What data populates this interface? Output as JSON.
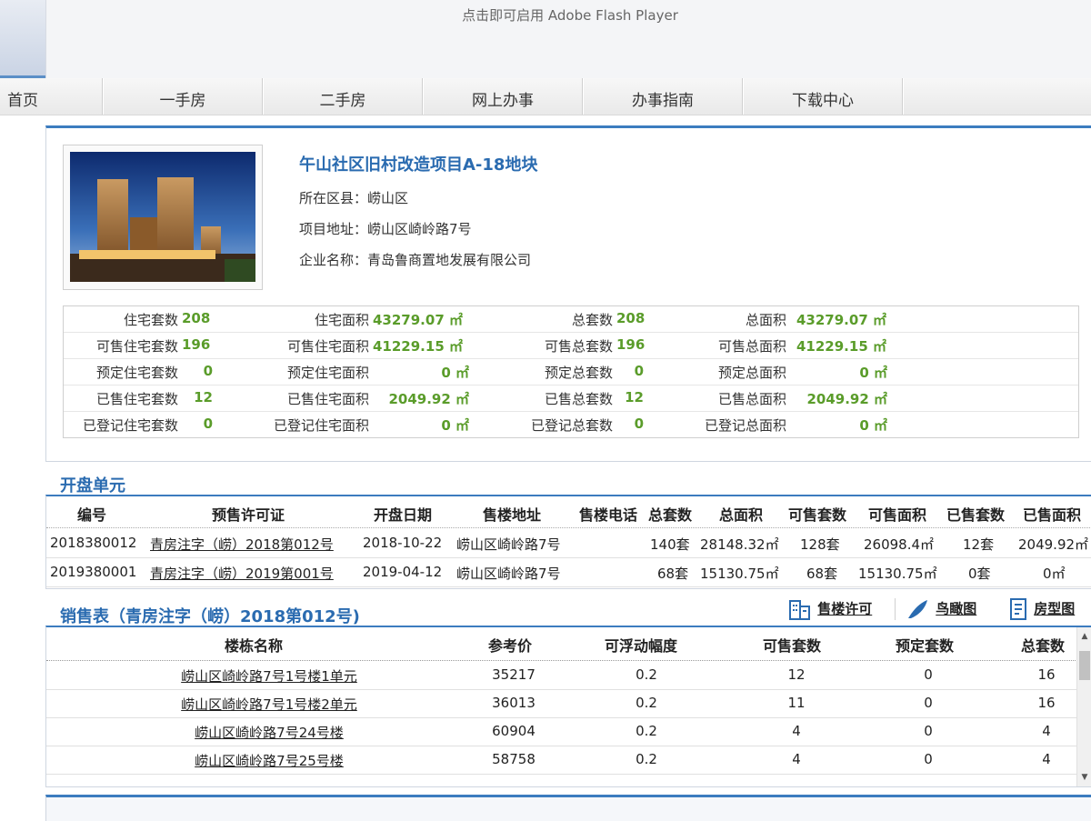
{
  "banner": {
    "flash_text": "点击即可启用 Adobe Flash Player"
  },
  "nav": {
    "items": [
      "首页",
      "一手房",
      "二手房",
      "网上办事",
      "办事指南",
      "下载中心"
    ]
  },
  "project": {
    "title": "午山社区旧村改造项目A-18地块",
    "district_label": "所在区县：",
    "district": "崂山区",
    "address_label": "项目地址：",
    "address": "崂山区崎岭路7号",
    "company_label": "企业名称：",
    "company": "青岛鲁商置地发展有限公司"
  },
  "stats": [
    [
      "住宅套数",
      "208",
      "住宅面积",
      "43279.07 ㎡",
      "总套数",
      "208",
      "总面积",
      "43279.07 ㎡"
    ],
    [
      "可售住宅套数",
      "196",
      "可售住宅面积",
      "41229.15 ㎡",
      "可售总套数",
      "196",
      "可售总面积",
      "41229.15 ㎡"
    ],
    [
      "预定住宅套数",
      "0",
      "预定住宅面积",
      "0 ㎡",
      "预定总套数",
      "0",
      "预定总面积",
      "0 ㎡"
    ],
    [
      "已售住宅套数",
      "12",
      "已售住宅面积",
      "2049.92 ㎡",
      "已售总套数",
      "12",
      "已售总面积",
      "2049.92 ㎡"
    ],
    [
      "已登记住宅套数",
      "0",
      "已登记住宅面积",
      "0 ㎡",
      "已登记总套数",
      "0",
      "已登记总面积",
      "0 ㎡"
    ]
  ],
  "kaipan": {
    "title": "开盘单元",
    "headers": [
      "编号",
      "预售许可证",
      "开盘日期",
      "售楼地址",
      "售楼电话",
      "总套数",
      "总面积",
      "可售套数",
      "可售面积",
      "已售套数",
      "已售面积"
    ],
    "rows": [
      [
        "2018380012",
        "青房注字（崂）2018第012号",
        "2018-10-22",
        "崂山区崎岭路7号",
        "",
        "140套",
        "28148.32㎡",
        "128套",
        "26098.4㎡",
        "12套",
        "2049.92㎡"
      ],
      [
        "2019380001",
        "青房注字（崂）2019第001号",
        "2019-04-12",
        "崂山区崎岭路7号",
        "",
        "68套",
        "15130.75㎡",
        "68套",
        "15130.75㎡",
        "0套",
        "0㎡"
      ]
    ]
  },
  "sales": {
    "title": "销售表（青房注字（崂）2018第012号)",
    "tools": {
      "permit": "售楼许可",
      "aerial": "鸟瞰图",
      "floorplan": "房型图"
    },
    "headers": [
      "楼栋名称",
      "参考价",
      "可浮动幅度",
      "可售套数",
      "预定套数",
      "总套数"
    ],
    "rows": [
      [
        "崂山区崎岭路7号1号楼1单元",
        "35217",
        "0.2",
        "12",
        "0",
        "16"
      ],
      [
        "崂山区崎岭路7号1号楼2单元",
        "36013",
        "0.2",
        "11",
        "0",
        "16"
      ],
      [
        "崂山区崎岭路7号24号楼",
        "60904",
        "0.2",
        "4",
        "0",
        "4"
      ],
      [
        "崂山区崎岭路7号25号楼",
        "58758",
        "0.2",
        "4",
        "0",
        "4"
      ]
    ]
  }
}
